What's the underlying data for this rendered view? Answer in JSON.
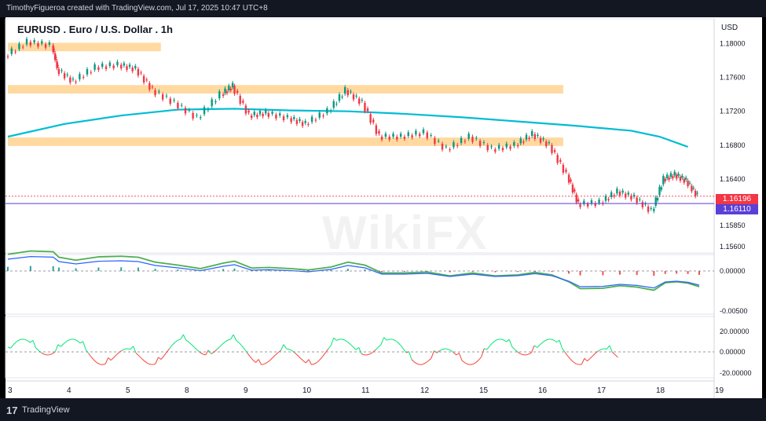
{
  "header": {
    "credit": "TimothyFigueroa created with TradingView.com, Jul 17, 2025 10:47 UTC+8"
  },
  "footer": {
    "logo": "17",
    "brand": "TradingView"
  },
  "watermark": "WikiFX",
  "chart_data": {
    "type": "candlestick",
    "title": "EURUSD . Euro / U.S. Dollar . 1h",
    "currency": "USD",
    "x_ticks": [
      "3",
      "4",
      "5",
      "8",
      "9",
      "10",
      "11",
      "12",
      "15",
      "16",
      "17",
      "18",
      "19"
    ],
    "price_axis": {
      "ticks": [
        "1.18000",
        "1.17600",
        "1.17200",
        "1.16800",
        "1.16400",
        "1.15850",
        "1.15600"
      ],
      "last_price": "1.16196",
      "last_price_color": "#f23645",
      "ma_price": "1.16110",
      "ma_price_color": "#5b3fd6"
    },
    "macd_axis": {
      "ticks": [
        "0.00000",
        "-0.00500"
      ]
    },
    "oscillator_axis": {
      "ticks": [
        "20.00000",
        "0.00000",
        "-20.00000"
      ]
    },
    "zones": [
      {
        "from": 3.0,
        "to": 5.7,
        "price_low": 1.1791,
        "price_high": 1.1801
      },
      {
        "from": 3.0,
        "to": 12.8,
        "price_low": 1.1741,
        "price_high": 1.1751
      },
      {
        "from": 3.0,
        "to": 12.8,
        "price_low": 1.1679,
        "price_high": 1.1689
      }
    ],
    "moving_average": [
      [
        3.0,
        1.169
      ],
      [
        4.0,
        1.1705
      ],
      [
        5.0,
        1.1715
      ],
      [
        6.0,
        1.1722
      ],
      [
        7.0,
        1.1723
      ],
      [
        8.0,
        1.1721
      ],
      [
        9.0,
        1.172
      ],
      [
        10.0,
        1.1717
      ],
      [
        11.0,
        1.1713
      ],
      [
        12.0,
        1.1708
      ],
      [
        13.0,
        1.1703
      ],
      [
        14.0,
        1.1697
      ],
      [
        14.5,
        1.169
      ],
      [
        15.0,
        1.1678
      ]
    ],
    "price_path": [
      [
        3.0,
        1.1785
      ],
      [
        3.4,
        1.1802
      ],
      [
        3.8,
        1.1798
      ],
      [
        3.9,
        1.177
      ],
      [
        4.2,
        1.1755
      ],
      [
        4.6,
        1.1772
      ],
      [
        5.0,
        1.1775
      ],
      [
        5.3,
        1.177
      ],
      [
        5.6,
        1.1745
      ],
      [
        6.0,
        1.173
      ],
      [
        6.4,
        1.1712
      ],
      [
        6.8,
        1.174
      ],
      [
        7.0,
        1.175
      ],
      [
        7.3,
        1.1715
      ],
      [
        7.6,
        1.1718
      ],
      [
        8.0,
        1.1712
      ],
      [
        8.3,
        1.1705
      ],
      [
        8.7,
        1.172
      ],
      [
        9.0,
        1.1745
      ],
      [
        9.3,
        1.173
      ],
      [
        9.6,
        1.169
      ],
      [
        10.0,
        1.169
      ],
      [
        10.4,
        1.1695
      ],
      [
        10.8,
        1.1675
      ],
      [
        11.2,
        1.169
      ],
      [
        11.6,
        1.1675
      ],
      [
        12.0,
        1.168
      ],
      [
        12.3,
        1.1693
      ],
      [
        12.6,
        1.168
      ],
      [
        12.9,
        1.1645
      ],
      [
        13.1,
        1.161
      ],
      [
        13.5,
        1.1612
      ],
      [
        13.8,
        1.1625
      ],
      [
        14.1,
        1.1618
      ],
      [
        14.4,
        1.1602
      ],
      [
        14.6,
        1.164
      ],
      [
        14.8,
        1.1645
      ],
      [
        15.0,
        1.1638
      ],
      [
        15.2,
        1.162
      ]
    ],
    "macd_zero_value": 0.0,
    "oscillator_zero_value": 0.0
  }
}
